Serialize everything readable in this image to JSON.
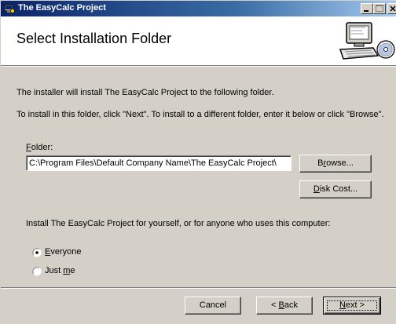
{
  "window": {
    "title": "The EasyCalc Project"
  },
  "header": {
    "title": "Select Installation Folder",
    "art_icon": "computer-install-icon"
  },
  "body": {
    "intro": "The installer will install The EasyCalc Project  to the following folder.",
    "instructions": "To install in this folder, click \"Next\". To install to a different folder, enter it below or click \"Browse\".",
    "folder_label_mnemonic": "F",
    "folder_label_rest": "older:",
    "folder_value": "C:\\Program Files\\Default Company Name\\The EasyCalc Project\\",
    "browse": {
      "pre": "B",
      "mnemonic": "r",
      "post": "owse..."
    },
    "disk_cost": {
      "mnemonic": "D",
      "post": "isk Cost..."
    },
    "install_for": "Install The EasyCalc Project  for yourself, or for anyone who uses this computer:",
    "radio_options": [
      {
        "mnemonic": "E",
        "post": "veryone",
        "selected": true
      },
      {
        "pre": "Just ",
        "mnemonic": "m",
        "post": "e",
        "selected": false
      }
    ]
  },
  "footer": {
    "cancel": "Cancel",
    "back": {
      "pre": "< ",
      "mnemonic": "B",
      "post": "ack"
    },
    "next": {
      "mnemonic": "N",
      "post": "ext >"
    }
  },
  "colors": {
    "titlebar_start": "#0a246a",
    "titlebar_end": "#a6caf0",
    "face": "#d4d0c8"
  }
}
